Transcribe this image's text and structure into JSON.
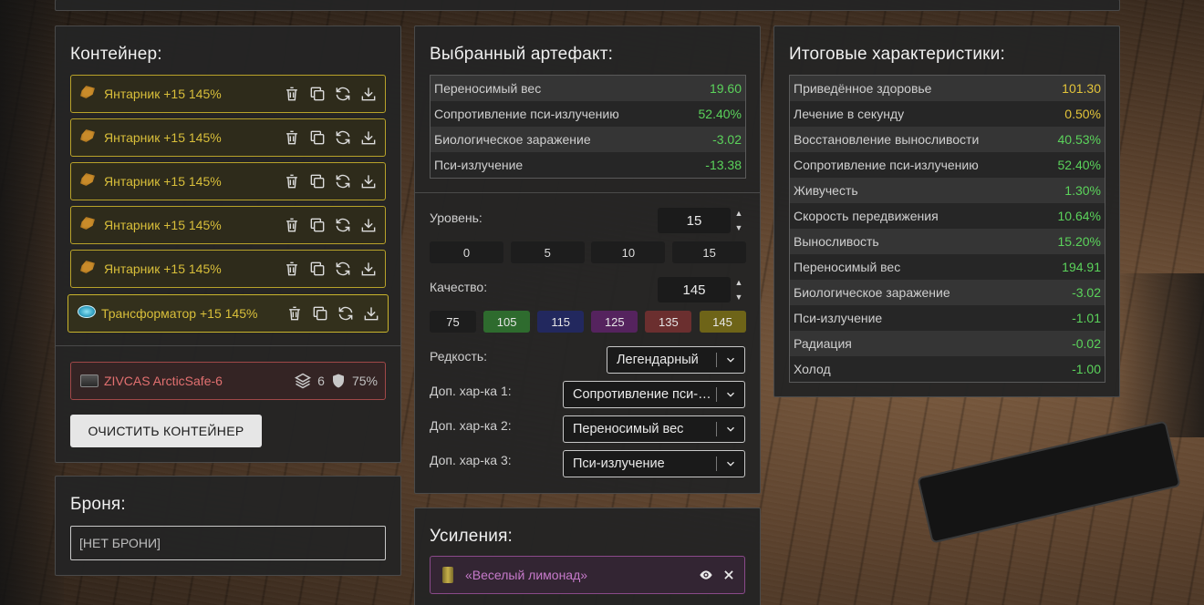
{
  "container": {
    "title": "Контейнер:",
    "artifacts": [
      {
        "name": "Янтарник +15 145%",
        "icon": "amber-artifact-icon"
      },
      {
        "name": "Янтарник +15 145%",
        "icon": "amber-artifact-icon"
      },
      {
        "name": "Янтарник +15 145%",
        "icon": "amber-artifact-icon"
      },
      {
        "name": "Янтарник +15 145%",
        "icon": "amber-artifact-icon"
      },
      {
        "name": "Янтарник +15 145%",
        "icon": "amber-artifact-icon"
      },
      {
        "name": "Трансформатор +15 145%",
        "icon": "transformer-artifact-icon"
      }
    ],
    "container_item": {
      "name": "ZIVCAS ArcticSafe-6",
      "slots": "6",
      "protection": "75%"
    },
    "clear_button": "ОЧИСТИТЬ КОНТЕЙНЕР"
  },
  "armor": {
    "title": "Броня:",
    "value": "[НЕТ БРОНИ]"
  },
  "selected": {
    "title": "Выбранный артефакт:",
    "stats": [
      {
        "label": "Переносимый вес",
        "value": "19.60",
        "color": "green"
      },
      {
        "label": "Сопротивление пси-излучению",
        "value": "52.40%",
        "color": "green"
      },
      {
        "label": "Биологическое заражение",
        "value": "-3.02",
        "color": "green"
      },
      {
        "label": "Пси-излучение",
        "value": "-13.38",
        "color": "green"
      }
    ],
    "level_label": "Уровень:",
    "level_value": "15",
    "level_presets": [
      "0",
      "5",
      "10",
      "15"
    ],
    "quality_label": "Качество:",
    "quality_value": "145",
    "quality_presets": [
      {
        "label": "75",
        "color": "#1d1d1d"
      },
      {
        "label": "105",
        "color": "#2e6b2e"
      },
      {
        "label": "115",
        "color": "#22285e"
      },
      {
        "label": "125",
        "color": "#55235e"
      },
      {
        "label": "135",
        "color": "#6b2f2f"
      },
      {
        "label": "145",
        "color": "#6e6418"
      }
    ],
    "rarity_label": "Редкость:",
    "rarity_value": "Легендарный",
    "extra1_label": "Доп. хар-ка 1:",
    "extra1_value": "Сопротивление пси-излучению",
    "extra2_label": "Доп. хар-ка 2:",
    "extra2_value": "Переносимый вес",
    "extra3_label": "Доп. хар-ка 3:",
    "extra3_value": "Пси-излучение"
  },
  "boosts": {
    "title": "Усиления:",
    "items": [
      {
        "name": "«Веселый лимонад»"
      }
    ]
  },
  "totals": {
    "title": "Итоговые характеристики:",
    "stats": [
      {
        "label": "Приведённое здоровье",
        "value": "101.30",
        "color": "yellow"
      },
      {
        "label": "Лечение в секунду",
        "value": "0.50%",
        "color": "yellow"
      },
      {
        "label": "Восстановление выносливости",
        "value": "40.53%",
        "color": "green"
      },
      {
        "label": "Сопротивление пси-излучению",
        "value": "52.40%",
        "color": "green"
      },
      {
        "label": "Живучесть",
        "value": "1.30%",
        "color": "green"
      },
      {
        "label": "Скорость передвижения",
        "value": "10.64%",
        "color": "green"
      },
      {
        "label": "Выносливость",
        "value": "15.20%",
        "color": "green"
      },
      {
        "label": "Переносимый вес",
        "value": "194.91",
        "color": "green"
      },
      {
        "label": "Биологическое заражение",
        "value": "-3.02",
        "color": "green"
      },
      {
        "label": "Пси-излучение",
        "value": "-1.01",
        "color": "green"
      },
      {
        "label": "Радиация",
        "value": "-0.02",
        "color": "green"
      },
      {
        "label": "Холод",
        "value": "-1.00",
        "color": "green"
      }
    ]
  },
  "colors": {
    "accent_yellow": "#d9bf3a",
    "green": "#5bd35b",
    "red_container": "#e27070",
    "purple_boost": "#c77acb"
  }
}
